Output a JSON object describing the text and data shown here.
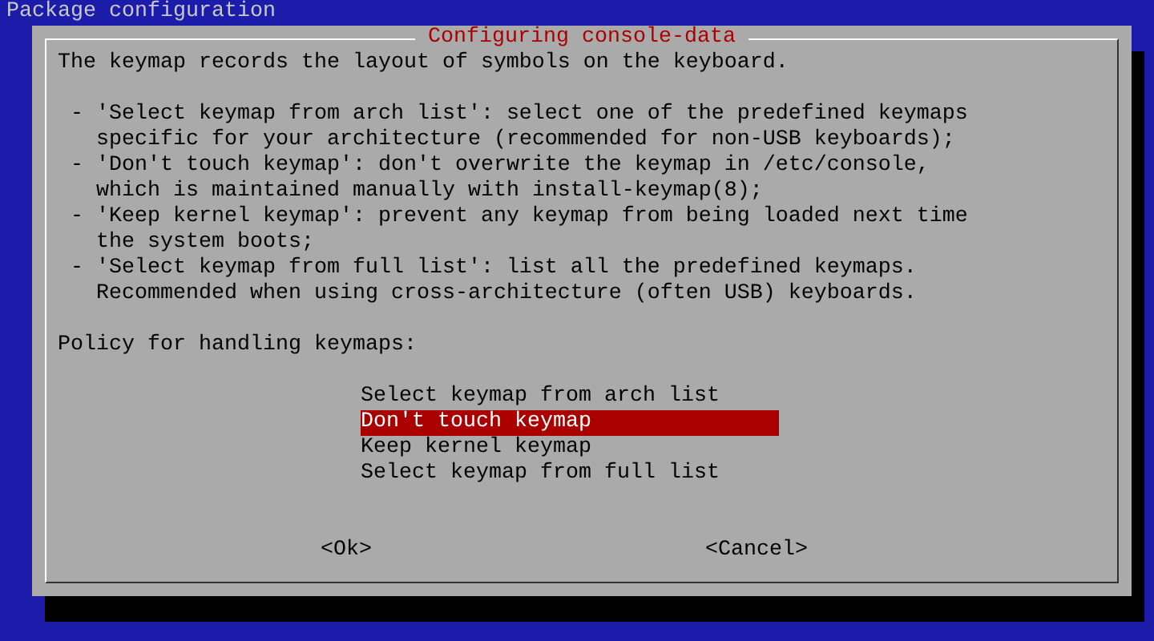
{
  "screen_title": "Package configuration",
  "dialog": {
    "title": "Configuring console-data",
    "intro": "The keymap records the layout of symbols on the keyboard.",
    "bullets": [
      {
        "lines": [
          "- 'Select keymap from arch list': select one of the predefined keymaps",
          "specific for your architecture (recommended for non-USB keyboards);"
        ]
      },
      {
        "lines": [
          "- 'Don't touch keymap': don't overwrite the keymap in /etc/console,",
          "which is maintained manually with install-keymap(8);"
        ]
      },
      {
        "lines": [
          "- 'Keep kernel keymap': prevent any keymap from being loaded next time",
          "the system boots;"
        ]
      },
      {
        "lines": [
          "- 'Select keymap from full list': list all the predefined keymaps.",
          "Recommended when using cross-architecture (often USB) keyboards."
        ]
      }
    ],
    "prompt": "Policy for handling keymaps:",
    "options": [
      {
        "label": "Select keymap from arch list",
        "selected": false
      },
      {
        "label": "Don't touch keymap",
        "selected": true
      },
      {
        "label": "Keep kernel keymap",
        "selected": false
      },
      {
        "label": "Select keymap from full list",
        "selected": false
      }
    ],
    "buttons": [
      "<Ok>",
      "<Cancel>"
    ]
  }
}
